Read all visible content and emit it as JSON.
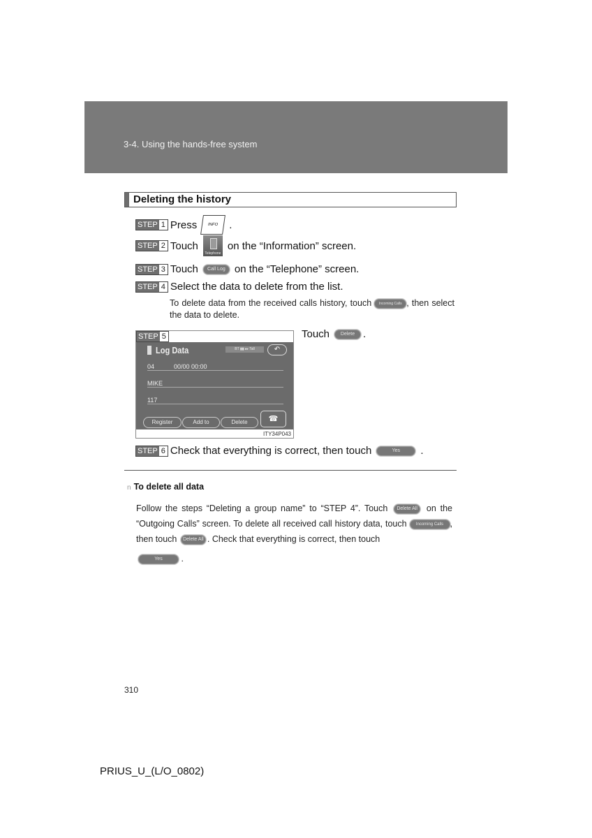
{
  "header": {
    "section": "3-4. Using the hands-free system"
  },
  "section_title": "Deleting the history",
  "step_label": "STEP",
  "steps": [
    {
      "num": "1",
      "pre": "Press",
      "button": "INFO",
      "post": "."
    },
    {
      "num": "2",
      "pre": "Touch",
      "button": "Telephone",
      "post": "on the “Information” screen."
    },
    {
      "num": "3",
      "pre": "Touch",
      "button": "Call Log",
      "post": "on the “Telephone” screen."
    },
    {
      "num": "4",
      "pre": "Select the data to delete from the list."
    },
    {
      "num": "5",
      "pre": "Touch",
      "button": "Delete",
      "post": "."
    },
    {
      "num": "6",
      "pre": "Check that everything is correct, then touch",
      "button": "Yes",
      "post": "."
    }
  ],
  "step4_note": {
    "pre": "To delete data from the received calls history, touch",
    "button": "Incoming Calls",
    "post": ", then select the data to delete."
  },
  "screen": {
    "title": "Log Data",
    "status": "BT ▮▮ ▸▸ Tall",
    "back_icon": "↶",
    "rows": [
      "04",
      "00/00  00:00",
      "MIKE",
      "117"
    ],
    "buttons": [
      "Register",
      "Add to",
      "Delete"
    ],
    "call_icon": "☎",
    "figure_id": "ITY34P043"
  },
  "delete_all": {
    "heading": "To delete all data",
    "bullet": "n",
    "p1": "Follow the steps “Deleting a group name” to “STEP 4”. Touch",
    "btn_delete_all": "Delete All",
    "p2": "on the “Outgoing Calls” screen. To delete all received call history data, touch",
    "btn_incoming": "Incoming Calls",
    "p3": ", then touch",
    "p4": ". Check that everything is correct, then touch",
    "btn_yes": "Yes",
    "p5": "."
  },
  "page_number": "310",
  "footer": "PRIUS_U_(L/O_0802)"
}
